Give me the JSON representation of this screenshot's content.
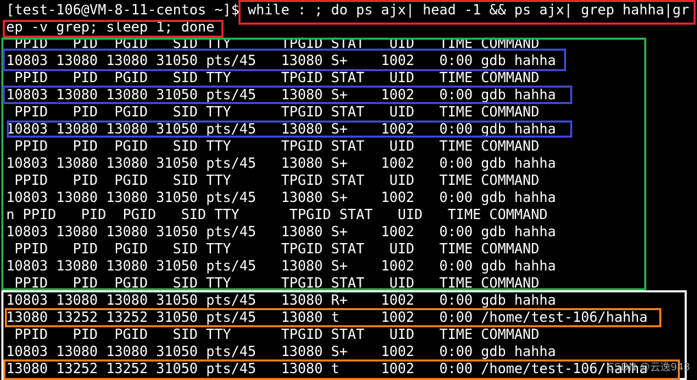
{
  "terminal": {
    "lines": [
      "[test-106@VM-8-11-centos ~]$ while : ; do ps ajx| head -1 && ps ajx| grep hahha|gr",
      "ep -v grep; sleep 1; done",
      " PPID   PID  PGID   SID TTY      TPGID STAT   UID   TIME COMMAND",
      "10803 13080 13080 31050 pts/45   13080 S+    1002   0:00 gdb hahha",
      " PPID   PID  PGID   SID TTY      TPGID STAT   UID   TIME COMMAND",
      "10803 13080 13080 31050 pts/45   13080 S+    1002   0:00 gdb hahha",
      " PPID   PID  PGID   SID TTY      TPGID STAT   UID   TIME COMMAND",
      "10803 13080 13080 31050 pts/45   13080 S+    1002   0:00 gdb hahha",
      " PPID   PID  PGID   SID TTY      TPGID STAT   UID   TIME COMMAND",
      "10803 13080 13080 31050 pts/45   13080 S+    1002   0:00 gdb hahha",
      " PPID   PID  PGID   SID TTY      TPGID STAT   UID   TIME COMMAND",
      "10803 13080 13080 31050 pts/45   13080 S+    1002   0:00 gdb hahha",
      "n PPID   PID  PGID   SID TTY      TPGID STAT   UID   TIME COMMAND",
      "10803 13080 13080 31050 pts/45   13080 S+    1002   0:00 gdb hahha",
      " PPID   PID  PGID   SID TTY      TPGID STAT   UID   TIME COMMAND",
      "10803 13080 13080 31050 pts/45   13080 S+    1002   0:00 gdb hahha",
      " PPID   PID  PGID   SID TTY      TPGID STAT   UID   TIME COMMAND",
      "10803 13080 13080 31050 pts/45   13080 R+    1002   0:00 gdb hahha",
      "13080 13252 13252 31050 pts/45   13080 t     1002   0:00 /home/test-106/hahha",
      " PPID   PID  PGID   SID TTY      TPGID STAT   UID   TIME COMMAND",
      "10803 13080 13080 31050 pts/45   13080 S+    1002   0:00 gdb hahha",
      "13080 13252 13252 31050 pts/45   13080 t     1002   0:00 /home/test-106/hahha"
    ]
  },
  "watermark": "CSDN @云逸943",
  "annotation_colors": {
    "red": "#e8262b",
    "green": "#22b14c",
    "blue": "#3f48cc",
    "white": "#ffffff",
    "orange": "#f07c1c"
  }
}
